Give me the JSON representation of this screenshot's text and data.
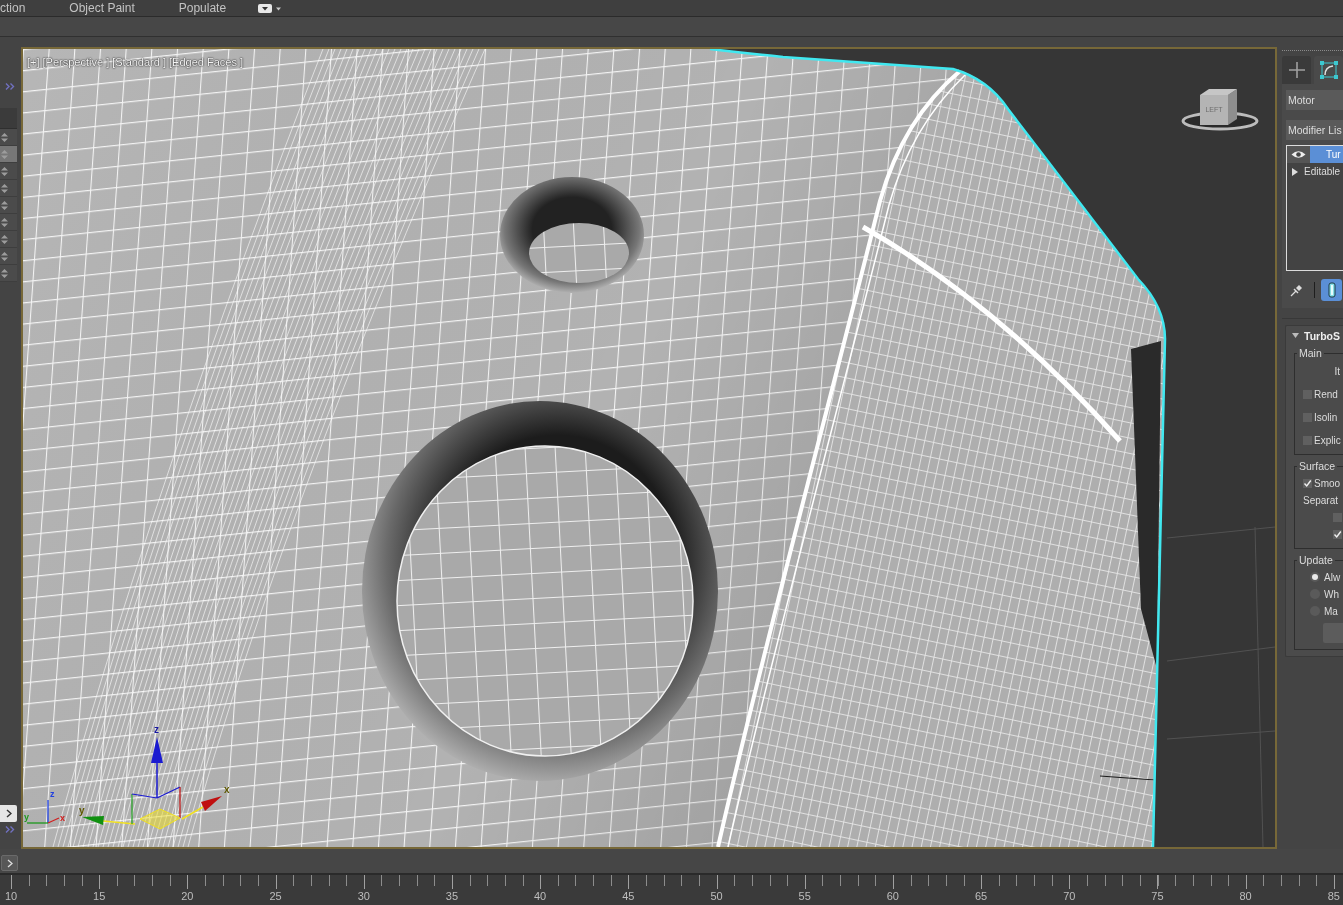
{
  "menu_bar": {
    "items": [
      "ction",
      "Object Paint",
      "Populate"
    ]
  },
  "left_toolbar": {
    "rows": [
      {
        "selected": false
      },
      {
        "selected": true
      },
      {
        "selected": false
      },
      {
        "selected": false
      },
      {
        "selected": false
      },
      {
        "selected": false
      },
      {
        "selected": false
      },
      {
        "selected": false
      },
      {
        "selected": false
      }
    ]
  },
  "viewport": {
    "labels": [
      "[+]",
      "[Perspective ]",
      "[Standard ]",
      "[Edged Faces ]"
    ],
    "view_cube": {
      "face_label": "LEFT"
    },
    "axis_tripod": {
      "axis_labels": [
        "z",
        "y",
        "x"
      ]
    },
    "transform_gizmo": {
      "axis_labels": [
        "z",
        "y",
        "x"
      ]
    }
  },
  "command_panel": {
    "tabs": [
      {
        "kind": "create",
        "selected": false
      },
      {
        "kind": "modify",
        "selected": true
      }
    ],
    "object_name": "Motor",
    "modifier_list": "Modifier Lis",
    "stack": [
      {
        "kind": "modifier",
        "label": "Tur",
        "selected": true
      },
      {
        "kind": "base",
        "label": "Editable",
        "selected": false
      }
    ],
    "stack_tools": [
      {
        "kind": "pin",
        "on": false
      },
      {
        "kind": "show-end-result",
        "on": true
      }
    ],
    "rollout": {
      "title": "TurboS",
      "expanded": true,
      "groups": [
        {
          "title": "Main",
          "items": [
            {
              "kind": "spinner-label",
              "label": "It"
            },
            {
              "kind": "checkbox",
              "label": "Rend",
              "checked": false
            },
            {
              "kind": "checkbox",
              "label": "Isolin",
              "checked": false
            },
            {
              "kind": "checkbox",
              "label": "Explic",
              "checked": false
            }
          ]
        },
        {
          "title": "Surface",
          "items": [
            {
              "kind": "checkbox",
              "label": "Smoo",
              "checked": true
            },
            {
              "kind": "label",
              "label": "Separat"
            },
            {
              "kind": "checkbox",
              "checked": false
            },
            {
              "kind": "checkbox",
              "checked": true
            }
          ]
        },
        {
          "title": "Update",
          "items": [
            {
              "kind": "radio",
              "label": "Alw",
              "selected": true
            },
            {
              "kind": "radio",
              "label": "Wh",
              "selected": false
            },
            {
              "kind": "radio",
              "label": "Ma",
              "selected": false
            },
            {
              "kind": "button"
            }
          ]
        }
      ]
    }
  },
  "timeline": {
    "frame_labels": [
      "10",
      "15",
      "20",
      "25",
      "30",
      "35",
      "40",
      "45",
      "50",
      "55",
      "60",
      "65",
      "70",
      "75",
      "80",
      "85"
    ]
  }
}
